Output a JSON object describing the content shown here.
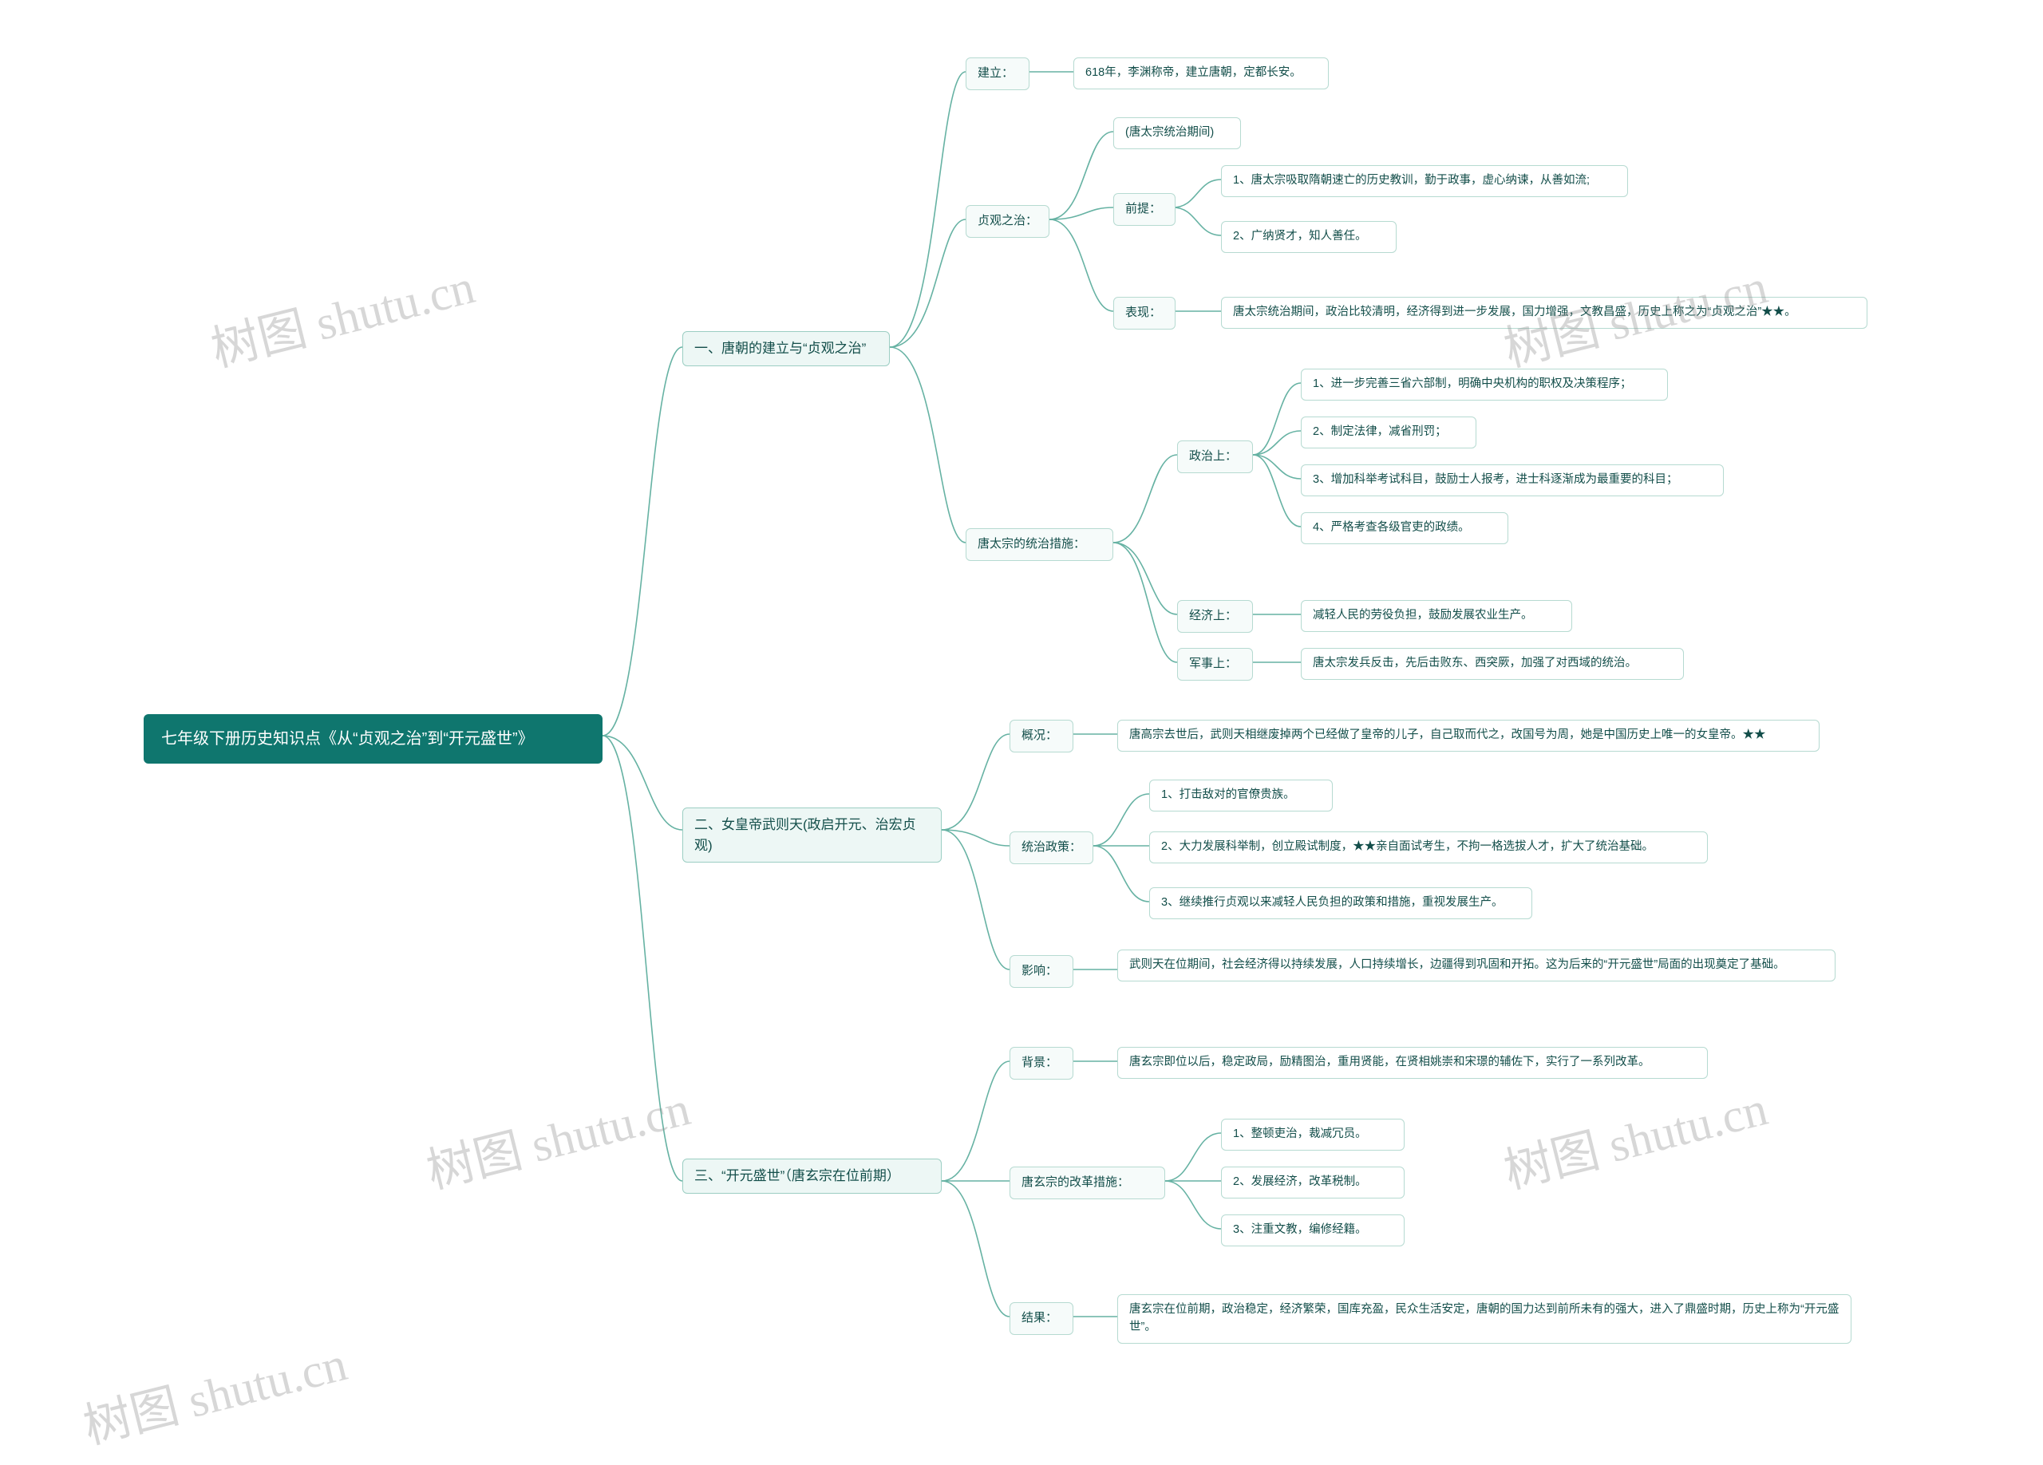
{
  "root": "七年级下册历史知识点《从“贞观之治”到“开元盛世”》",
  "b1": {
    "title": "一、唐朝的建立与“贞观之治”",
    "establish": {
      "label": "建立：",
      "text": "618年，李渊称帝，建立唐朝，定都长安。"
    },
    "zhenguan": {
      "label": "贞观之治：",
      "period": "(唐太宗统治期间)",
      "pre_label": "前提：",
      "pre1": "1、唐太宗吸取隋朝速亡的历史教训，勤于政事，虚心纳谏，从善如流;",
      "pre2": "2、广纳贤才，知人善任。",
      "perf_label": "表现：",
      "perf": "唐太宗统治期间，政治比较清明，经济得到进一步发展，国力增强，文教昌盛，历史上称之为“贞观之治”★★。"
    },
    "measures": {
      "label": "唐太宗的统治措施：",
      "pol_label": "政治上：",
      "pol1": "1、进一步完善三省六部制，明确中央机构的职权及决策程序；",
      "pol2": "2、制定法律，减省刑罚；",
      "pol3": "3、增加科举考试科目，鼓励士人报考，进士科逐渐成为最重要的科目；",
      "pol4": "4、严格考查各级官吏的政绩。",
      "eco_label": "经济上：",
      "eco": "减轻人民的劳役负担，鼓励发展农业生产。",
      "mil_label": "军事上：",
      "mil": "唐太宗发兵反击，先后击败东、西突厥，加强了对西域的统治。"
    }
  },
  "b2": {
    "title": "二、女皇帝武则天(政启开元、治宏贞观)",
    "overview_label": "概况：",
    "overview": "唐高宗去世后，武则天相继废掉两个已经做了皇帝的儿子，自己取而代之，改国号为周，她是中国历史上唯一的女皇帝。★★",
    "policy_label": "统治政策：",
    "policy1": "1、打击敌对的官僚贵族。",
    "policy2": "2、大力发展科举制，创立殿试制度，★★亲自面试考生，不拘一格选拔人才，扩大了统治基础。",
    "policy3": "3、继续推行贞观以来减轻人民负担的政策和措施，重视发展生产。",
    "impact_label": "影响：",
    "impact": "武则天在位期间，社会经济得以持续发展，人口持续增长，边疆得到巩固和开拓。这为后来的“开元盛世”局面的出现奠定了基础。"
  },
  "b3": {
    "title": "三、“开元盛世”（唐玄宗在位前期）",
    "bg_label": "背景：",
    "bg": "唐玄宗即位以后，稳定政局，励精图治，重用贤能，在贤相姚崇和宋璟的辅佐下，实行了一系列改革。",
    "reform_label": "唐玄宗的改革措施：",
    "r1": "1、整顿吏治，裁减冗员。",
    "r2": "2、发展经济，改革税制。",
    "r3": "3、注重文教，编修经籍。",
    "result_label": "结果：",
    "result": "唐玄宗在位前期，政治稳定，经济繁荣，国库充盈，民众生活安定，唐朝的国力达到前所未有的强大，进入了鼎盛时期，历史上称为“开元盛世”。"
  },
  "watermark": "树图 shutu.cn"
}
